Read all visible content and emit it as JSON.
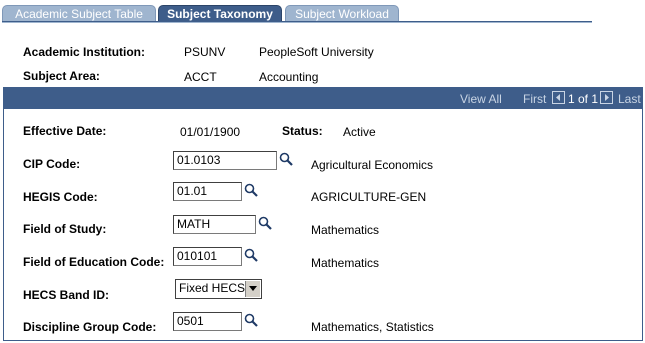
{
  "tabs": [
    {
      "label": "Academic Subject Table",
      "active": false
    },
    {
      "label": "Subject Taxonomy",
      "active": true
    },
    {
      "label": "Subject Workload",
      "active": false
    }
  ],
  "header": {
    "institution_label": "Academic Institution:",
    "institution_code": "PSUNV",
    "institution_name": "PeopleSoft University",
    "subject_label": "Subject Area:",
    "subject_code": "ACCT",
    "subject_name": "Accounting"
  },
  "scroll": {
    "view_all": "View All",
    "first": "First",
    "page_info": "1 of 1",
    "last": "Last"
  },
  "form": {
    "effective_date_label": "Effective Date:",
    "effective_date": "01/01/1900",
    "status_label": "Status:",
    "status": "Active",
    "cip_label": "CIP Code:",
    "cip_value": "01.0103",
    "cip_desc": "Agricultural Economics",
    "hegis_label": "HEGIS Code:",
    "hegis_value": "01.01",
    "hegis_desc": "AGRICULTURE-GEN",
    "field_study_label": "Field of Study:",
    "field_study_value": "MATH",
    "field_study_desc": "Mathematics",
    "field_edu_label": "Field of Education Code:",
    "field_edu_value": "010101",
    "field_edu_desc": "Mathematics",
    "hecs_label": "HECS Band ID:",
    "hecs_value": "Fixed HECS",
    "discipline_label": "Discipline Group Code:",
    "discipline_value": "0501",
    "discipline_desc": "Mathematics, Statistics"
  },
  "colors": {
    "tab_active": "#3e5d8a",
    "tab_inactive": "#9fb5cf",
    "scroll_header": "#3e5d8a"
  }
}
